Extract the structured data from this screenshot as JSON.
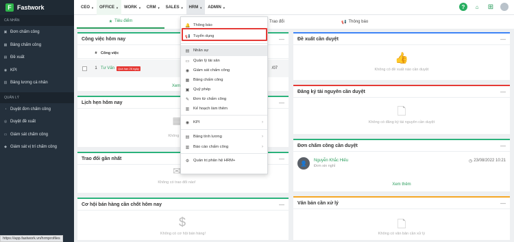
{
  "app": {
    "name": "Fastwork"
  },
  "sidebar": {
    "section_personal": "CÁ NHÂN",
    "personal_items": [
      {
        "label": "Đơn chấm công",
        "icon": "file-icon"
      },
      {
        "label": "Bảng chấm công",
        "icon": "table-icon"
      },
      {
        "label": "Đề xuất",
        "icon": "proposal-icon"
      },
      {
        "label": "KPI",
        "icon": "eye-icon"
      },
      {
        "label": "Bảng lương cá nhân",
        "icon": "salary-icon"
      }
    ],
    "section_manage": "QUẢN LÝ",
    "manage_items": [
      {
        "label": "Duyệt đơn chấm công",
        "icon": "approve-icon"
      },
      {
        "label": "Duyệt đề xuất",
        "icon": "approve-proposal-icon"
      },
      {
        "label": "Giám sát chấm công",
        "icon": "monitor-icon"
      },
      {
        "label": "Giám sát vị trí chấm công",
        "icon": "location-icon"
      }
    ]
  },
  "topnav": {
    "items": [
      "CEO",
      "OFFICE",
      "WORK",
      "CRM",
      "SALES",
      "HRM",
      "ADMIN"
    ],
    "active": "HRM"
  },
  "tabs": {
    "focus": "Tiêu điểm",
    "discuss": "Trao đổi",
    "notify": "Thông báo"
  },
  "hrm_menu": {
    "items": [
      {
        "label": "Thông báo",
        "icon": "bell-icon"
      },
      {
        "label": "Tuyển dụng",
        "icon": "megaphone-icon"
      },
      {
        "label": "Nhân sự",
        "icon": "book-icon"
      },
      {
        "label": "Quản lý tài sản",
        "icon": "monitor-icon"
      },
      {
        "label": "Giám sát chấm công",
        "icon": "user-icon"
      },
      {
        "label": "Bảng chấm công",
        "icon": "table-icon"
      },
      {
        "label": "Quỹ phép",
        "icon": "calendar-icon"
      },
      {
        "label": "Đơn từ chấm công",
        "icon": "edit-icon"
      },
      {
        "label": "Kế hoạch làm thêm",
        "icon": "clipboard-icon"
      },
      {
        "label": "KPI",
        "icon": "eye-icon"
      },
      {
        "label": "Bảng tính lương",
        "icon": "salary-icon"
      },
      {
        "label": "Báo cáo chấm công",
        "icon": "chart-icon"
      },
      {
        "label": "Quản trị phân hệ HRM+",
        "icon": "gear-icon"
      }
    ]
  },
  "cards": {
    "today_work": {
      "title": "Công việc hôm nay",
      "col_no": "#",
      "col_task": "Công việc",
      "row_no": "1",
      "row_task": "Tư Vấn",
      "row_badge": "Quá hạn 26 ngày",
      "row_date": "/07",
      "more": "Xem"
    },
    "appointments": {
      "title": "Lịch hẹn hôm nay",
      "empty": "Không có"
    },
    "recent_discuss": {
      "title": "Trao đổi gần nhất",
      "empty": "Không có trao đổi nào!"
    },
    "sales_opps": {
      "title": "Cơ hội bán hàng cần chốt hôm nay",
      "empty": "Không có cơ hội bán hàng!"
    },
    "proposals": {
      "title": "Đề xuất cần duyệt",
      "empty": "Không có đề xuất nào cần duyệt"
    },
    "resource_reg": {
      "title": "Đăng ký tài nguyên cần duyệt",
      "empty": "Không có đăng ký tài nguyên cần duyệt"
    },
    "attendance": {
      "title": "Đơn chấm công cần duyệt",
      "person": "Nguyễn Khắc Hiếu",
      "type": "Đơn xin nghỉ",
      "time": "23/08/2022 10:21",
      "more": "Xem thêm"
    },
    "documents": {
      "title": "Văn bản cần xử lý",
      "empty": "Không có văn bản cần xử lý"
    }
  },
  "statusbar": {
    "url": "https://app.fastwork.vn/hrmprofiles"
  },
  "colors": {
    "accent": "#2a9d5c",
    "sidebar": "#24303c",
    "danger": "#e53935",
    "info": "#3b82f6"
  }
}
